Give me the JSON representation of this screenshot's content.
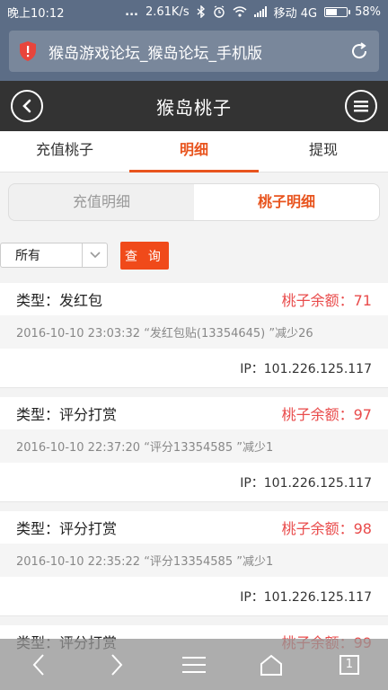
{
  "status_bar": {
    "time": "晚上10:12",
    "dots": "...",
    "speed": "2.61K/s",
    "carrier": "移动 4G",
    "battery": "58%",
    "battery_level": 0.58
  },
  "browser": {
    "page_title": "猴岛游戏论坛_猴岛论坛_手机版"
  },
  "header": {
    "title": "猴岛桃子"
  },
  "tabs": [
    {
      "label": "充值桃子",
      "active": false
    },
    {
      "label": "明细",
      "active": true
    },
    {
      "label": "提现",
      "active": false
    }
  ],
  "segment": {
    "items": [
      {
        "label": "充值明细",
        "active": false
      },
      {
        "label": "桃子明细",
        "active": true
      }
    ]
  },
  "filter": {
    "select_value": "所有",
    "query_label": "查 询"
  },
  "records": [
    {
      "type": "类型：发红包",
      "balance": "桃子余额：71",
      "detail": "2016-10-10 23:03:32 “发红包贴(13354645) ”减少26",
      "ip": "IP：101.226.125.117"
    },
    {
      "type": "类型：评分打赏",
      "balance": "桃子余额：97",
      "detail": "2016-10-10 22:37:20 “评分13354585 ”减少1",
      "ip": "IP：101.226.125.117"
    },
    {
      "type": "类型：评分打赏",
      "balance": "桃子余额：98",
      "detail": "2016-10-10 22:35:22 “评分13354585 ”减少1",
      "ip": "IP：101.226.125.117"
    },
    {
      "type": "类型：评分打赏",
      "balance": "桃子余额：99",
      "detail": "",
      "ip": ""
    }
  ],
  "bottom_bar": {
    "tab_count": "1"
  },
  "colors": {
    "accent": "#e8541e",
    "balance_red": "#e94b4b",
    "header_bg": "#333333",
    "status_bg": "#5c6d86"
  }
}
